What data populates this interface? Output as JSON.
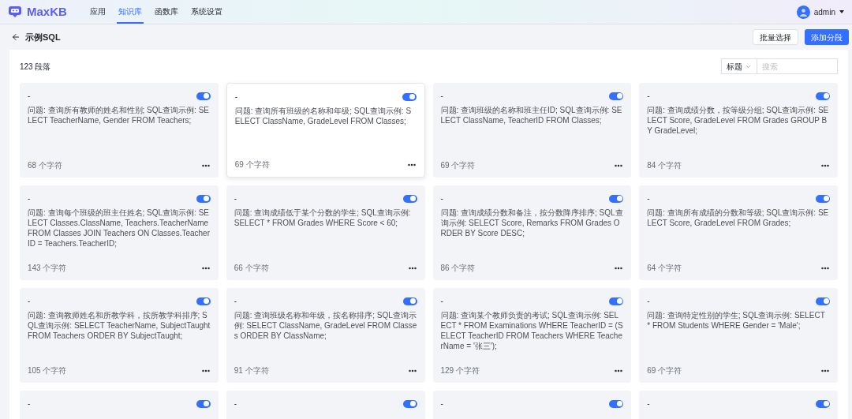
{
  "header": {
    "logo": "MaxKB",
    "nav": [
      {
        "label": "应用",
        "selected": false
      },
      {
        "label": "知识库",
        "selected": true
      },
      {
        "label": "函数库",
        "selected": false
      },
      {
        "label": "系统设置",
        "selected": false
      }
    ],
    "user": "admin"
  },
  "page": {
    "title": "示例SQL",
    "buttons": [
      {
        "label": "批量选择",
        "kind": "secondary"
      },
      {
        "label": "添加分段",
        "kind": "primary"
      }
    ]
  },
  "list": {
    "count": "123 段落",
    "filter": {
      "value": "标题"
    },
    "search": {
      "placeholder": "搜索"
    },
    "cards": [
      {
        "title": "-",
        "on": true,
        "hovered": false,
        "content": "问题: 查询所有教师的姓名和性别; SQL查询示例: SELECT TeacherName, Gender FROM Teachers;",
        "chars": "68 个字符"
      },
      {
        "title": "-",
        "on": true,
        "hovered": true,
        "content": "问题: 查询所有班级的名称和年级; SQL查询示例: SELECT ClassName, GradeLevel FROM Classes;",
        "chars": "69 个字符"
      },
      {
        "title": "-",
        "on": true,
        "hovered": false,
        "content": "问题: 查询班级的名称和班主任ID; SQL查询示例: SELECT ClassName, TeacherID FROM Classes;",
        "chars": "69 个字符"
      },
      {
        "title": "-",
        "on": true,
        "hovered": false,
        "content": "问题: 查询成绩分数，按等级分组; SQL查询示例: SELECT Score, GradeLevel FROM Grades GROUP BY GradeLevel;",
        "chars": "84 个字符"
      },
      {
        "title": "-",
        "on": true,
        "hovered": false,
        "content": "问题: 查询每个班级的班主任姓名; SQL查询示例: SELECT Classes.ClassName, Teachers.TeacherName FROM Classes JOIN Teachers ON Classes.TeacherID = Teachers.TeacherID;",
        "chars": "143 个字符"
      },
      {
        "title": "-",
        "on": true,
        "hovered": false,
        "content": "问题: 查询成绩低于某个分数的学生; SQL查询示例: SELECT * FROM Grades WHERE Score < 60;",
        "chars": "66 个字符"
      },
      {
        "title": "-",
        "on": true,
        "hovered": false,
        "content": "问题: 查询成绩分数和备注，按分数降序排序; SQL查询示例: SELECT Score, Remarks FROM Grades ORDER BY Score DESC;",
        "chars": "86 个字符"
      },
      {
        "title": "-",
        "on": true,
        "hovered": false,
        "content": "问题: 查询所有成绩的分数和等级; SQL查询示例: SELECT Score, GradeLevel FROM Grades;",
        "chars": "64 个字符"
      },
      {
        "title": "-",
        "on": true,
        "hovered": false,
        "content": "问题: 查询教师姓名和所教学科，按所教学科排序; SQL查询示例: SELECT TeacherName, SubjectTaught FROM Teachers ORDER BY SubjectTaught;",
        "chars": "105 个字符"
      },
      {
        "title": "-",
        "on": true,
        "hovered": false,
        "content": "问题: 查询班级名称和年级，按名称排序; SQL查询示例: SELECT ClassName, GradeLevel FROM Classes ORDER BY ClassName;",
        "chars": "91 个字符"
      },
      {
        "title": "-",
        "on": true,
        "hovered": false,
        "content": "问题: 查询某个教师负责的考试; SQL查询示例: SELECT * FROM Examinations WHERE TeacherID = (SELECT TeacherID FROM Teachers WHERE TeacherName = '张三');",
        "chars": "129 个字符"
      },
      {
        "title": "-",
        "on": true,
        "hovered": false,
        "content": "问题: 查询特定性别的学生; SQL查询示例: SELECT * FROM Students WHERE Gender = 'Male';",
        "chars": "69 个字符"
      },
      {
        "title": "-",
        "on": true,
        "hovered": false
      },
      {
        "title": "-",
        "on": true,
        "hovered": false
      },
      {
        "title": "-",
        "on": true,
        "hovered": false
      },
      {
        "title": "-",
        "on": true,
        "hovered": false
      }
    ]
  }
}
